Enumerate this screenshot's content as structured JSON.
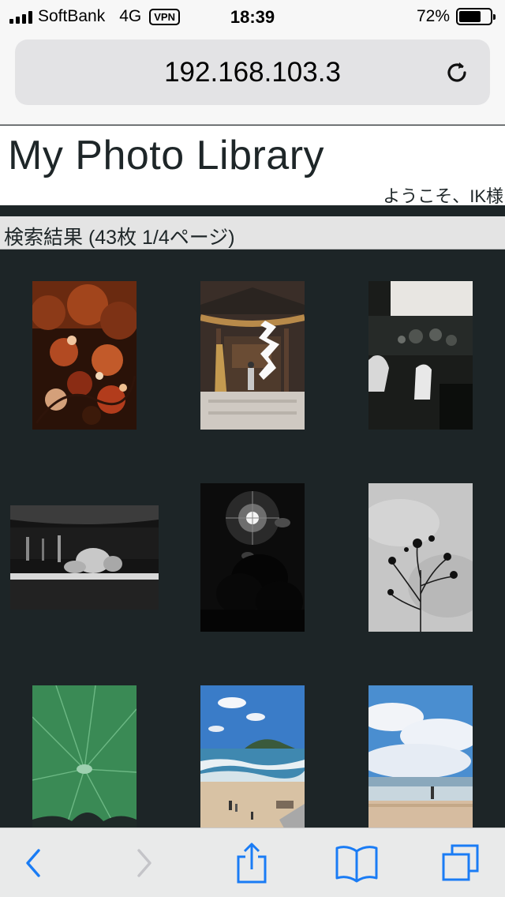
{
  "status_bar": {
    "carrier": "SoftBank",
    "network": "4G",
    "vpn": "VPN",
    "time": "18:39",
    "battery": "72%",
    "battery_level": 0.72
  },
  "browser": {
    "url": "192.168.103.3",
    "reload_icon": "reload-icon"
  },
  "page": {
    "title": "My Photo Library",
    "welcome": "ようこそ、IK様",
    "result_summary": "検索結果 (43枚 1/4ページ)"
  },
  "photos": [
    {
      "subject": "autumn-leaves"
    },
    {
      "subject": "shrine"
    },
    {
      "subject": "train-driver"
    },
    {
      "subject": "stage-concert"
    },
    {
      "subject": "sun-and-tree"
    },
    {
      "subject": "cosmos-flowers"
    },
    {
      "subject": "lotus-leaf"
    },
    {
      "subject": "beach-island"
    },
    {
      "subject": "beach-sky"
    }
  ],
  "toolbar": {
    "icons": [
      "back-icon",
      "forward-icon",
      "share-icon",
      "bookmarks-icon",
      "tabs-icon"
    ],
    "accent": "#1a7cf5",
    "disabled": "#c4c4c8"
  }
}
